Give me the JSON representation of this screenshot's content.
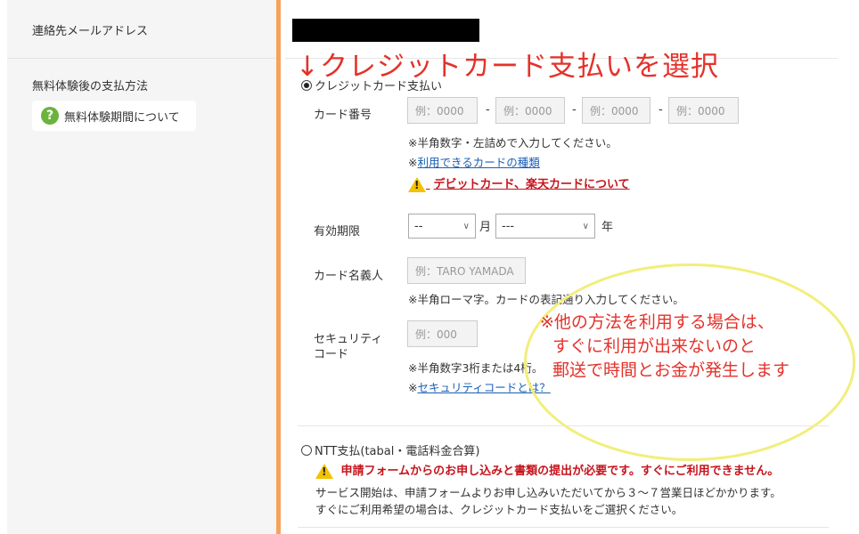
{
  "left": {
    "contact_email_label": "連絡先メールアドレス",
    "payment_after_trial_label": "無料体験後の支払方法",
    "trial_help_icon": "question-icon",
    "trial_help_label": "無料体験期間について"
  },
  "annotation": {
    "select_credit": "↓クレジットカード支払いを選択",
    "other_method_line1": "※他の方法を利用する場合は、",
    "other_method_line2": "すぐに利用が出来ないのと",
    "other_method_line3": "郵送で時間とお金が発生します"
  },
  "credit": {
    "radio_label": "クレジットカード支払い",
    "card_number_label": "カード番号",
    "card_placeholder": "例：0000",
    "dash": "-",
    "card_note": "※半角数字・左詰めで入力してください。",
    "available_prefix": "※",
    "available_link": "利用できるカードの種類",
    "debit_link": "デビットカード、楽天カードについて",
    "expiry_label": "有効期限",
    "month_value": "--",
    "month_unit": "月",
    "year_value": "---",
    "year_unit": "年",
    "holder_label": "カード名義人",
    "holder_placeholder": "例：TARO YAMADA",
    "holder_note": "※半角ローマ字。カードの表記通り入力してください。",
    "security_label_1": "セキュリティ",
    "security_label_2": "コード",
    "security_placeholder": "例：000",
    "security_note": "※半角数字3桁または4桁。",
    "security_prefix": "※",
    "security_link": "セキュリティコードとは？"
  },
  "ntt": {
    "radio_label": "NTT支払(tabal・電話料金合算)",
    "warning": "申請フォームからのお申し込みと書類の提出が必要です。すぐにご利用できません。",
    "note1": "サービス開始は、申請フォームよりお申し込みいただいてから３～７営業日ほどかかります。",
    "note2": "すぐにご利用希望の場合は、クレジットカード支払いをご選択ください。"
  },
  "colors": {
    "accent": "#f5a35a",
    "warning_red": "#c5141c",
    "link_blue": "#1a5fb4",
    "annotation_red": "#e4322b",
    "highlight_yellow": "#f2ee7a"
  }
}
